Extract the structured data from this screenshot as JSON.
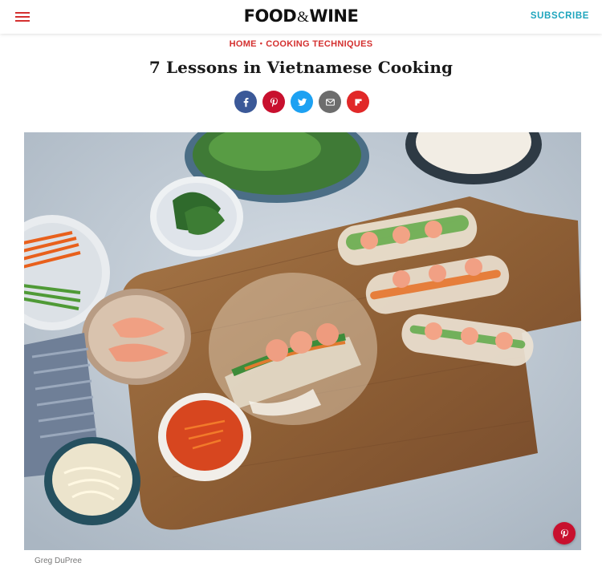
{
  "header": {
    "logo_left": "FOOD",
    "logo_amp": "&",
    "logo_right": "WINE",
    "subscribe_label": "SUBSCRIBE",
    "menu_icon": "hamburger-icon"
  },
  "breadcrumb": {
    "items": [
      "HOME",
      "COOKING TECHNIQUES"
    ],
    "separator": "•"
  },
  "article": {
    "title": "7 Lessons in Vietnamese Cooking",
    "photo_credit": "Greg DuPree"
  },
  "share": [
    {
      "network": "facebook",
      "icon": "facebook-icon",
      "color": "#3b5998"
    },
    {
      "network": "pinterest",
      "icon": "pinterest-icon",
      "color": "#c8102e"
    },
    {
      "network": "twitter",
      "icon": "twitter-icon",
      "color": "#1da1f2"
    },
    {
      "network": "email",
      "icon": "email-icon",
      "color": "#6d6d6d"
    },
    {
      "network": "flipboard",
      "icon": "flipboard-icon",
      "color": "#e12828"
    }
  ],
  "colors": {
    "accent": "#d4302f",
    "subscribe": "#1ea5bd"
  }
}
